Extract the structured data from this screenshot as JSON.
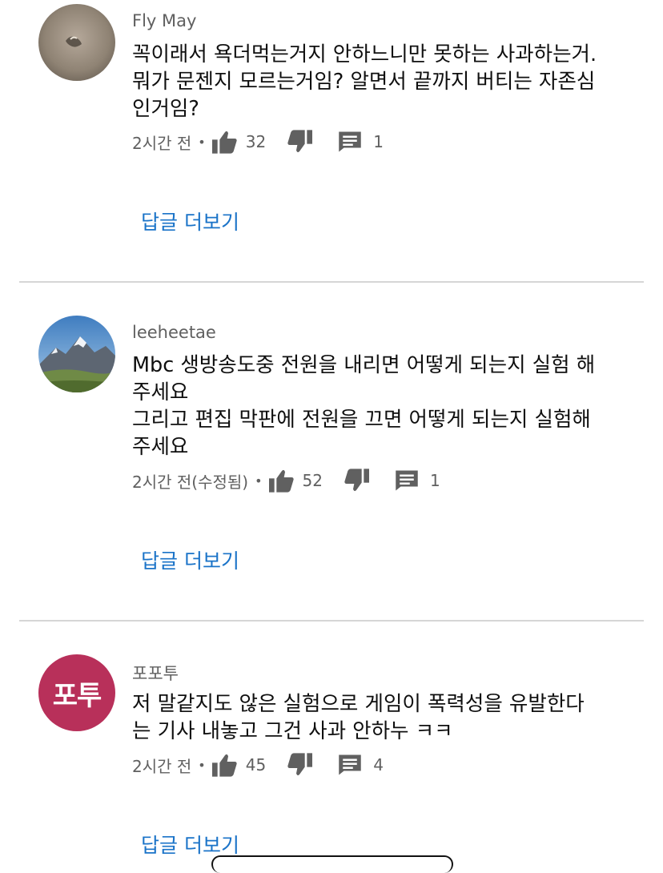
{
  "comments": [
    {
      "author": "Fly May",
      "text": "꼭이래서 욕더먹는거지 안하느니만 못하는 사과하는거.\n뭐가 문젠지 모르는거임? 알면서 끝까지 버티는 자존심\n인거임?",
      "time": "2시간 전",
      "likes": "32",
      "replies": "1",
      "more_label": "답글 더보기",
      "avatar_icon": "photo-avatar-stone"
    },
    {
      "author": "leeheetae",
      "text": "Mbc 생방송도중 전원을 내리면 어떻게 되는지 실험 해\n주세요\n그리고 편집 막판에 전원을 끄면 어떻게 되는지 실험해\n주세요",
      "time": "2시간 전(수정됨)",
      "likes": "52",
      "replies": "1",
      "more_label": "답글 더보기",
      "avatar_icon": "photo-avatar-mountain"
    },
    {
      "author": "포포투",
      "text": "저 말같지도 않은 실험으로 게임이 폭력성을 유발한다\n는 기사 내놓고 그건 사과 안하누 ㅋㅋ",
      "time": "2시간 전",
      "likes": "45",
      "replies": "4",
      "more_label": "답글 더보기",
      "avatar_text": "포투",
      "avatar_color": "#b8305a"
    }
  ],
  "separator": "•",
  "colors": {
    "link": "#1a73c8",
    "meta": "#606060",
    "divider": "#d6d6d6"
  }
}
